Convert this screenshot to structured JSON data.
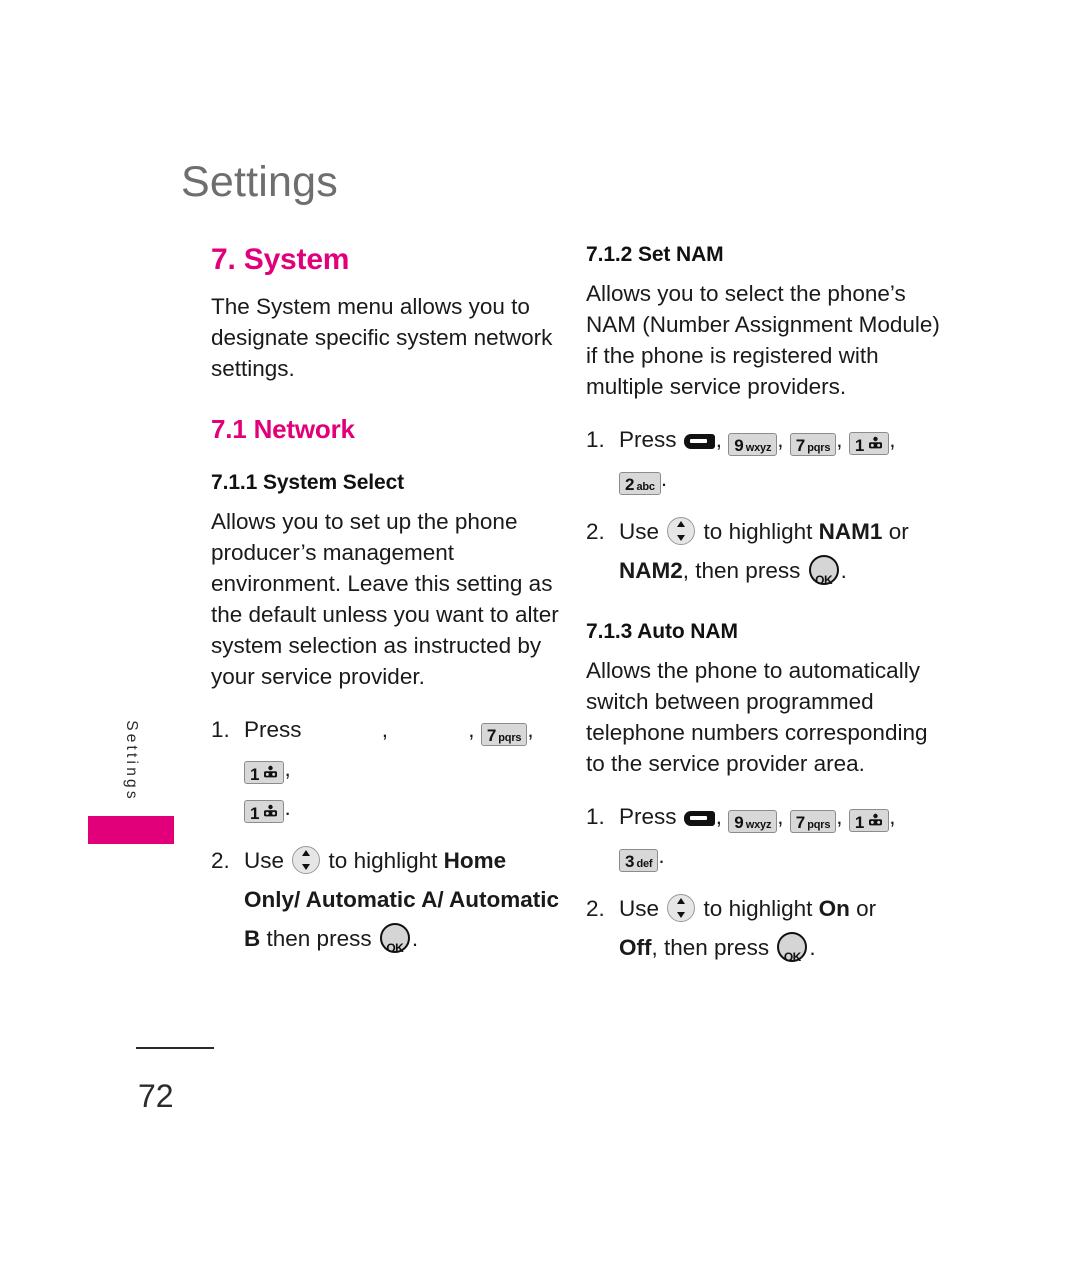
{
  "running_head": "Settings",
  "side_tab": {
    "label": "Settings",
    "accent_color": "#e2007a"
  },
  "folio": "72",
  "accent_color": "#e2007a",
  "left_column": {
    "chapter_heading": "7. System",
    "chapter_intro": "The System menu allows you to designate specific system network settings.",
    "section_heading": "7.1 Network",
    "subsection_heading": "7.1.1 System Select",
    "subsection_body": "Allows you to set up the phone producer’s management environment. Leave this setting as the default unless you want to alter system selection as instructed by your service provider.",
    "steps": [
      {
        "number": "1.",
        "verb": "Press",
        "keys": [
          {
            "type": "blank"
          },
          {
            "type": "blank"
          },
          {
            "type": "digit",
            "digit": "7",
            "letters": "pqrs"
          },
          {
            "type": "digit",
            "digit": "1",
            "icon": "voicemail-icon"
          },
          {
            "type": "digit",
            "digit": "1",
            "icon": "voicemail-icon"
          }
        ],
        "terminator": "."
      },
      {
        "number": "2.",
        "verb": "Use",
        "nav_key": "navigation-key",
        "text_before": "to highlight",
        "options": "Home Only/ Automatic A/ Automatic B",
        "text_after": "then press",
        "ok_key": "OK",
        "terminator": "."
      }
    ]
  },
  "right_column": {
    "sections": [
      {
        "heading": "7.1.2 Set NAM",
        "body": "Allows you to select the phone’s NAM (Number Assignment Module) if the phone is registered with multiple service providers.",
        "steps": [
          {
            "number": "1.",
            "verb": "Press",
            "keys": [
              {
                "type": "menu"
              },
              {
                "type": "digit",
                "digit": "9",
                "letters": "wxyz"
              },
              {
                "type": "digit",
                "digit": "7",
                "letters": "pqrs"
              },
              {
                "type": "digit",
                "digit": "1",
                "icon": "voicemail-icon"
              },
              {
                "type": "digit",
                "digit": "2",
                "letters": "abc"
              }
            ],
            "terminator": "."
          },
          {
            "number": "2.",
            "verb": "Use",
            "nav_key": "navigation-key",
            "text_before": "to highlight",
            "option_a": "NAM1",
            "conjunction": "or",
            "option_b": "NAM2",
            "text_after": ", then press",
            "ok_key": "OK",
            "terminator": "."
          }
        ]
      },
      {
        "heading": "7.1.3 Auto NAM",
        "body": "Allows the phone to automatically switch between programmed telephone numbers corresponding to the service provider area.",
        "steps": [
          {
            "number": "1.",
            "verb": "Press",
            "keys": [
              {
                "type": "menu"
              },
              {
                "type": "digit",
                "digit": "9",
                "letters": "wxyz"
              },
              {
                "type": "digit",
                "digit": "7",
                "letters": "pqrs"
              },
              {
                "type": "digit",
                "digit": "1",
                "icon": "voicemail-icon"
              },
              {
                "type": "digit",
                "digit": "3",
                "letters": "def"
              }
            ],
            "terminator": "."
          },
          {
            "number": "2.",
            "verb": "Use",
            "nav_key": "navigation-key",
            "text_before": "to highlight",
            "option_a": "On",
            "conjunction": "or",
            "option_b": "Off",
            "text_after": ", then press",
            "ok_key": "OK",
            "terminator": "."
          }
        ]
      }
    ]
  }
}
